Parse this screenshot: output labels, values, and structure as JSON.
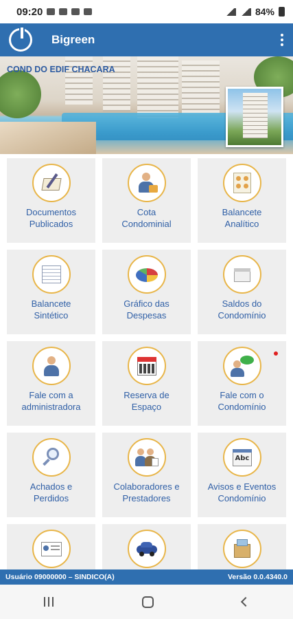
{
  "status_bar": {
    "time": "09:20",
    "battery": "84%"
  },
  "app_bar": {
    "title": "Bigreen"
  },
  "banner": {
    "condo_name": "COND DO EDIF CHACARA"
  },
  "tiles": [
    {
      "label": "Documentos\nPublicados",
      "icon": "documents-icon"
    },
    {
      "label": "Cota\nCondominial",
      "icon": "person-coins-icon"
    },
    {
      "label": "Balancete\nAnalítico",
      "icon": "analytic-sheet-icon"
    },
    {
      "label": "Balancete\nSintético",
      "icon": "synthetic-sheet-icon"
    },
    {
      "label": "Gráfico das\nDespesas",
      "icon": "pie-chart-icon"
    },
    {
      "label": "Saldos do\nCondomínio",
      "icon": "balance-icon"
    },
    {
      "label": "Fale com a\nadministradora",
      "icon": "person-icon"
    },
    {
      "label": "Reserva de\nEspaço",
      "icon": "calendar-icon"
    },
    {
      "label": "Fale com o\nCondomínio",
      "icon": "chat-person-icon",
      "badge": true
    },
    {
      "label": "Achados e\nPerdidos",
      "icon": "magnifier-icon"
    },
    {
      "label": "Colaboradores e\nPrestadores",
      "icon": "people-icon"
    },
    {
      "label": "Avisos e Eventos\nCondomínio",
      "icon": "notice-icon"
    },
    {
      "label": "",
      "icon": "id-card-icon"
    },
    {
      "label": "",
      "icon": "car-icon"
    },
    {
      "label": "",
      "icon": "box-icon"
    }
  ],
  "footer": {
    "user": "Usuário  09000000 – SINDICO(A)",
    "version": "Versão 0.0.4340.0"
  },
  "colors": {
    "primary": "#2f6fb0",
    "tile_bg": "#eeeeee",
    "label": "#2f5fa6",
    "ring": "#e8b548",
    "badge": "#e02020"
  }
}
